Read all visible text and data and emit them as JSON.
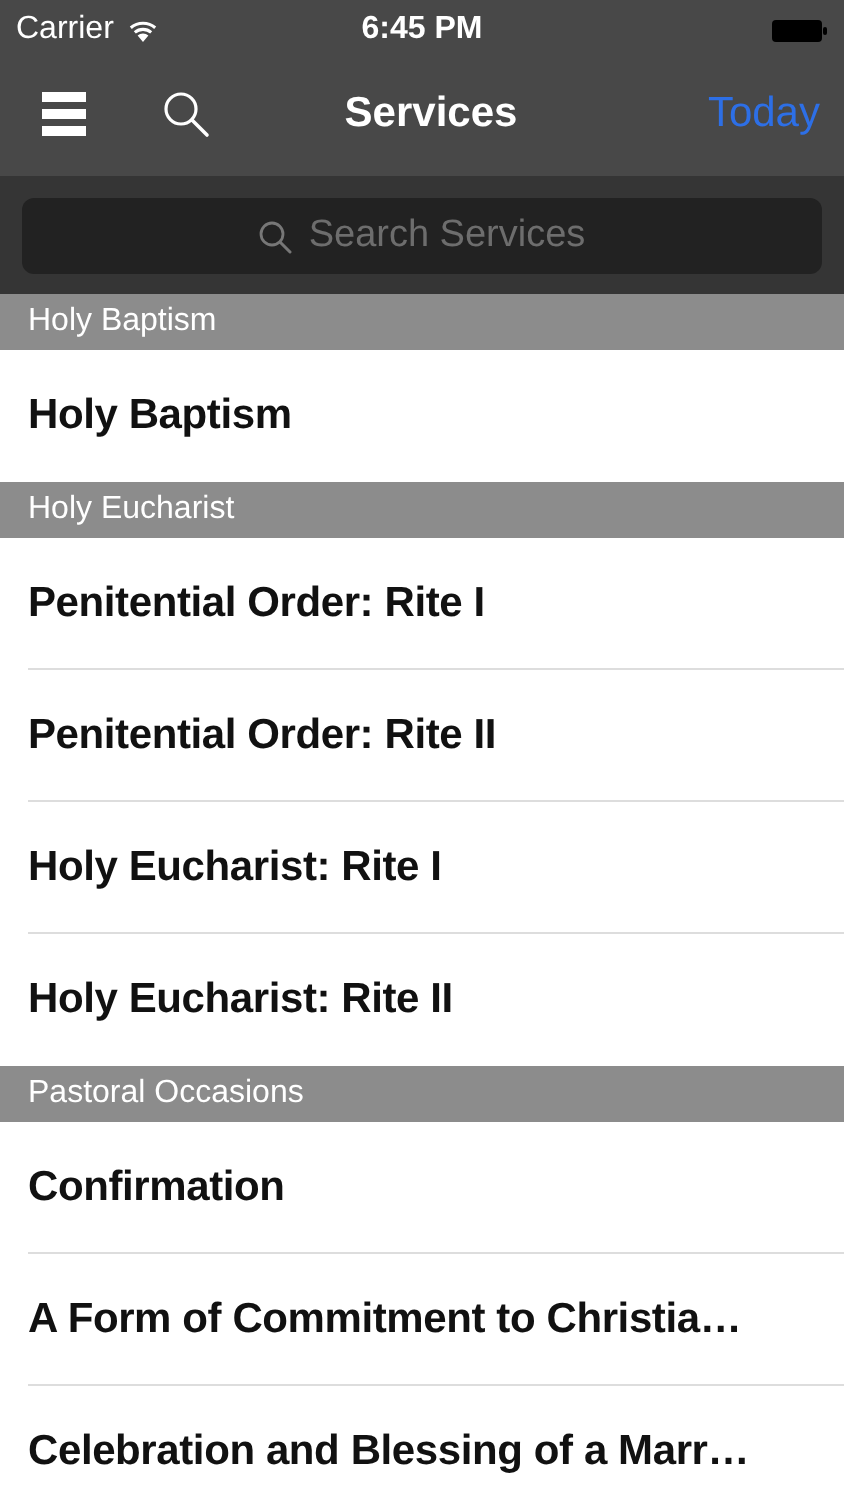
{
  "status_bar": {
    "carrier": "Carrier",
    "time": "6:45 PM"
  },
  "nav_bar": {
    "title": "Services",
    "right_button": "Today"
  },
  "search": {
    "placeholder": "Search Services"
  },
  "sections": [
    {
      "title": "Holy Baptism",
      "items": [
        "Holy Baptism"
      ]
    },
    {
      "title": "Holy Eucharist",
      "items": [
        "Penitential Order: Rite I",
        "Penitential Order: Rite II",
        "Holy Eucharist: Rite I",
        "Holy Eucharist: Rite II"
      ]
    },
    {
      "title": "Pastoral Occasions",
      "items": [
        "Confirmation",
        "A Form of Commitment to Christia…",
        "Celebration and Blessing of a Marr…"
      ]
    }
  ]
}
